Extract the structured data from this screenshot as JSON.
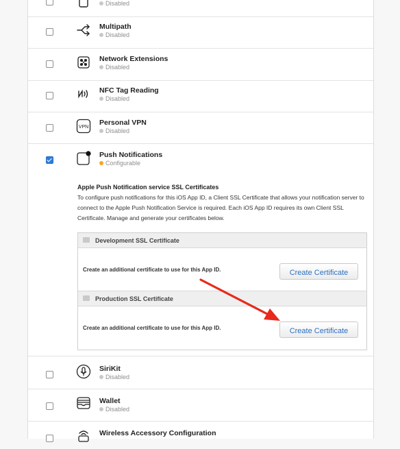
{
  "capabilities": [
    {
      "key": "prev",
      "name": "",
      "status": "Disabled",
      "checked": false
    },
    {
      "key": "multipath",
      "name": "Multipath",
      "status": "Disabled",
      "checked": false,
      "icon": "multipath-icon"
    },
    {
      "key": "network-extensions",
      "name": "Network Extensions",
      "status": "Disabled",
      "checked": false,
      "icon": "network-extensions-icon"
    },
    {
      "key": "nfc",
      "name": "NFC Tag Reading",
      "status": "Disabled",
      "checked": false,
      "icon": "nfc-icon"
    },
    {
      "key": "vpn",
      "name": "Personal VPN",
      "status": "Disabled",
      "checked": false,
      "icon": "vpn-icon",
      "icon_text": "VPN"
    },
    {
      "key": "push",
      "name": "Push Notifications",
      "status": "Configurable",
      "checked": true,
      "icon": "push-notifications-icon"
    },
    {
      "key": "sirikit",
      "name": "SiriKit",
      "status": "Disabled",
      "checked": false,
      "icon": "sirikit-icon"
    },
    {
      "key": "wallet",
      "name": "Wallet",
      "status": "Disabled",
      "checked": false,
      "icon": "wallet-icon"
    },
    {
      "key": "wireless",
      "name": "Wireless Accessory Configuration",
      "status": "",
      "checked": false,
      "icon": "wireless-accessory-icon"
    }
  ],
  "push_section": {
    "title": "Apple Push Notification service SSL Certificates",
    "description": "To configure push notifications for this iOS App ID, a Client SSL Certificate that allows your notification server to connect to the Apple Push Notification Service is required. Each iOS App ID requires its own Client SSL Certificate. Manage and generate your certificates below.",
    "development": {
      "header": "Development SSL Certificate",
      "text": "Create an additional certificate to use for this App ID.",
      "button": "Create Certificate"
    },
    "production": {
      "header": "Production SSL Certificate",
      "text": "Create an additional certificate to use for this App ID.",
      "button": "Create Certificate"
    }
  },
  "colors": {
    "accent": "#2b6fc2",
    "checked": "#2f7bd9",
    "configurable_dot": "#f5a623",
    "disabled_dot": "#c8c8c8",
    "annotation_arrow": "#e8291c"
  }
}
